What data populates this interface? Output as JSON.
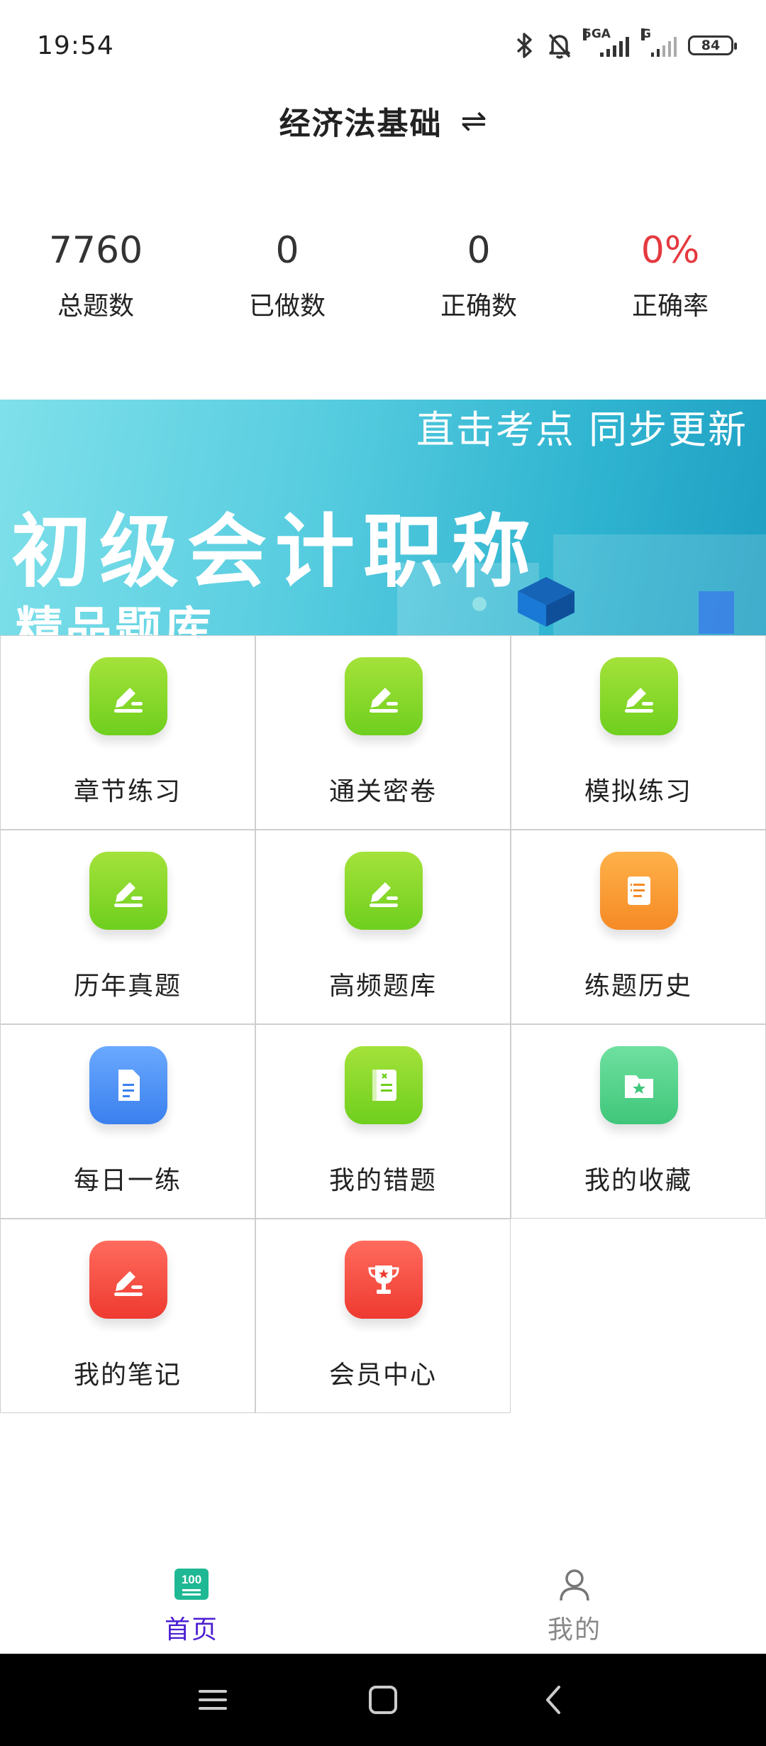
{
  "status_bar": {
    "time": "19:54",
    "network": "5GA",
    "network2": "G",
    "battery": "84"
  },
  "header": {
    "title": "经济法基础",
    "swap_icon": "swap-arrows-icon"
  },
  "stats": [
    {
      "value": "7760",
      "label": "总题数"
    },
    {
      "value": "0",
      "label": "已做数"
    },
    {
      "value": "0",
      "label": "正确数"
    },
    {
      "value": "0%",
      "label": "正确率",
      "color": "#e5393f"
    }
  ],
  "banner": {
    "slogan": "直击考点  同步更新",
    "title": "初级会计职称",
    "subtitle": "精品题库"
  },
  "menu": [
    {
      "label": "章节练习",
      "icon": "edit-icon",
      "color": "green"
    },
    {
      "label": "通关密卷",
      "icon": "edit-icon",
      "color": "green"
    },
    {
      "label": "模拟练习",
      "icon": "edit-icon",
      "color": "green"
    },
    {
      "label": "历年真题",
      "icon": "edit-icon",
      "color": "green"
    },
    {
      "label": "高频题库",
      "icon": "edit-icon",
      "color": "green"
    },
    {
      "label": "练题历史",
      "icon": "scroll-icon",
      "color": "orange"
    },
    {
      "label": "每日一练",
      "icon": "document-icon",
      "color": "blue"
    },
    {
      "label": "我的错题",
      "icon": "wrong-book-icon",
      "color": "green"
    },
    {
      "label": "我的收藏",
      "icon": "star-folder-icon",
      "color": "mint"
    },
    {
      "label": "我的笔记",
      "icon": "edit-icon",
      "color": "red"
    },
    {
      "label": "会员中心",
      "icon": "trophy-icon",
      "color": "red"
    }
  ],
  "tabs": [
    {
      "label": "首页",
      "icon": "score-100-icon",
      "badge": "100",
      "active": true
    },
    {
      "label": "我的",
      "icon": "user-icon",
      "active": false
    }
  ],
  "colors": {
    "accent": "#4b1fd1",
    "rate_red": "#e5393f",
    "green": "#6fcf1e"
  }
}
